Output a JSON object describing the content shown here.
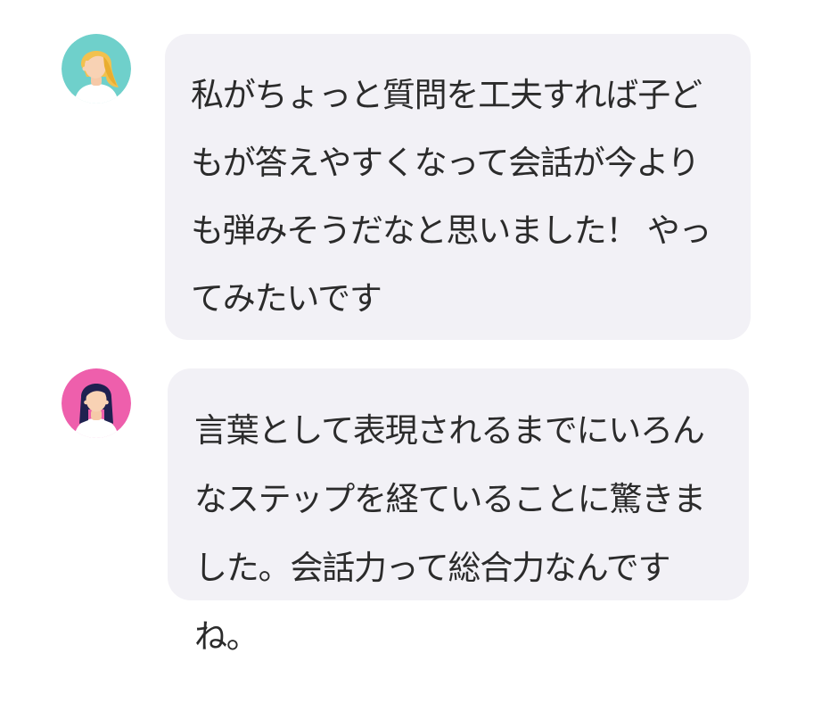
{
  "conversation": {
    "messages": [
      {
        "avatar_icon": "blonde-woman-avatar-icon",
        "avatar_bg": "#6fd0cb",
        "text": "私がちょっと質問を工夫すれば子どもが答えやすくなって会話が今よりも弾みそうだなと思いました！ やってみたいです"
      },
      {
        "avatar_icon": "dark-haired-woman-avatar-icon",
        "avatar_bg": "#ee5fac",
        "text": "言葉として表現されるまでにいろんなステップを経ていることに驚きました。会話力って総合力なんですね。"
      }
    ]
  },
  "colors": {
    "bubble_bg": "#f2f1f6",
    "text": "#2b2b2b",
    "page_bg": "#ffffff"
  }
}
